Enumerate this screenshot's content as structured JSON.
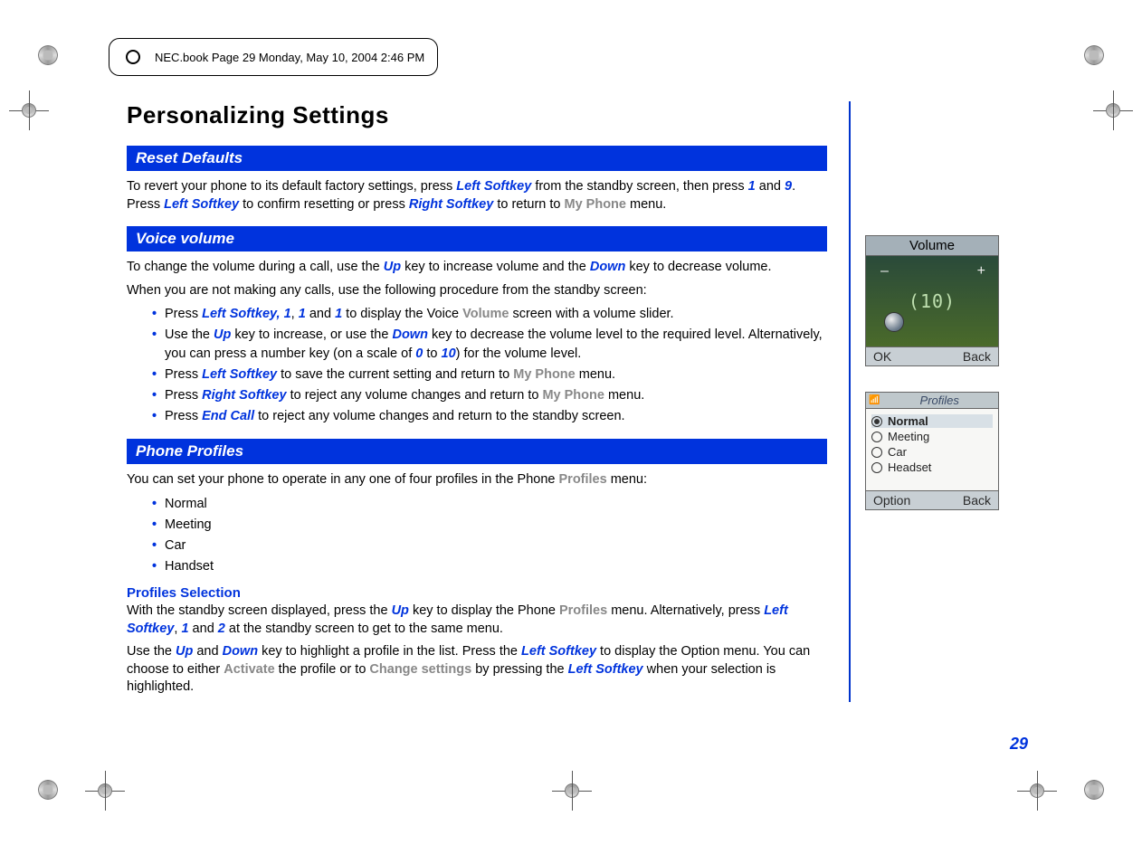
{
  "header": {
    "text": "NEC.book  Page 29  Monday, May 10, 2004  2:46 PM"
  },
  "page_number": "29",
  "h1": "Personalizing Settings",
  "sections": {
    "reset": {
      "title": "Reset Defaults",
      "p1_a": "To revert your phone to its default factory settings, press ",
      "p1_b": "Left Softkey",
      "p1_c": " from the standby screen, then press ",
      "p1_d": "1",
      "p1_e": " and ",
      "p1_f": "9",
      "p1_g": ". Press ",
      "p1_h": "Left Softkey",
      "p1_i": " to confirm resetting or press ",
      "p1_j": "Right Softkey",
      "p1_k": " to return to ",
      "p1_l": "My Phone",
      "p1_m": " menu."
    },
    "voice": {
      "title": "Voice volume",
      "p1_a": "To change the volume during a call, use the ",
      "p1_b": "Up",
      "p1_c": " key to increase volume and the ",
      "p1_d": "Down",
      "p1_e": " key to decrease volume.",
      "p2": "When you are not making any calls, use the following procedure from the standby screen:",
      "li1_a": "Press ",
      "li1_b": "Left Softkey, 1",
      "li1_c": ", ",
      "li1_d": "1",
      "li1_e": " and ",
      "li1_f": "1",
      "li1_g": " to display the Voice ",
      "li1_h": "Volume",
      "li1_i": " screen with a volume slider.",
      "li2_a": "Use the ",
      "li2_b": "Up",
      "li2_c": " key to increase, or use the ",
      "li2_d": "Down",
      "li2_e": " key to decrease the volume level to the  required level. Alternatively, you can press a number key (on a scale of ",
      "li2_f": "0",
      "li2_g": "  to ",
      "li2_h": "10",
      "li2_i": ") for the volume level.",
      "li3_a": "Press ",
      "li3_b": "Left Softkey",
      "li3_c": " to save the current setting and return to ",
      "li3_d": "My Phone",
      "li3_e": " menu.",
      "li4_a": "Press ",
      "li4_b": "Right Softkey",
      "li4_c": " to reject any volume changes and return to ",
      "li4_d": "My Phone",
      "li4_e": " menu.",
      "li5_a": "Press ",
      "li5_b": "End Call",
      "li5_c": " to reject any volume changes and return to the standby screen."
    },
    "profiles": {
      "title": "Phone Profiles",
      "p1_a": "You can set your phone to operate in any one of four profiles in the Phone ",
      "p1_b": "Profiles",
      "p1_c": " menu:",
      "items": [
        "Normal",
        "Meeting",
        "Car",
        "Handset"
      ],
      "sub": "Profiles Selection",
      "p2_a": "With the standby screen displayed, press the ",
      "p2_b": "Up",
      "p2_c": " key to display the Phone ",
      "p2_d": "Profiles",
      "p2_e": " menu. Alternatively, press ",
      "p2_f": "Left Softkey",
      "p2_g": ", ",
      "p2_h": "1",
      "p2_i": " and ",
      "p2_j": "2",
      "p2_k": " at the standby screen to get to the same menu.",
      "p3_a": "Use the ",
      "p3_b": "Up",
      "p3_c": " and ",
      "p3_d": "Down",
      "p3_e": " key to highlight a profile in the list. Press the ",
      "p3_f": "Left Softkey",
      "p3_g": " to display the Option menu. You can choose to either ",
      "p3_h": "Activate",
      "p3_i": " the profile or to ",
      "p3_j": "Change settings",
      "p3_k": " by pressing the ",
      "p3_l": "Left Softkey",
      "p3_m": " when your selection is highlighted."
    }
  },
  "phone_volume": {
    "title": "Volume",
    "value": "(10)",
    "ok": "OK",
    "back": "Back"
  },
  "phone_profiles": {
    "title": "Profiles",
    "options": [
      "Normal",
      "Meeting",
      "Car",
      "Headset"
    ],
    "selected_index": 0,
    "option_label": "Option",
    "back": "Back"
  }
}
